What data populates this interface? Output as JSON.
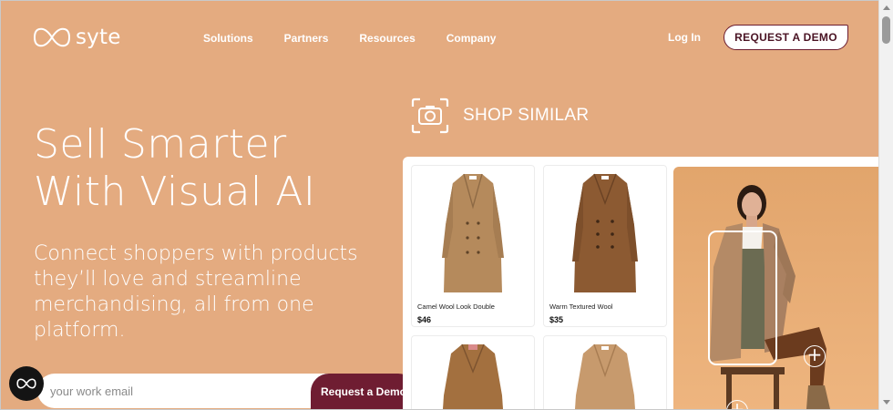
{
  "header": {
    "logo_text": "syte",
    "nav": [
      "Solutions",
      "Partners",
      "Resources",
      "Company"
    ],
    "login_label": "Log In",
    "demo_label": "REQUEST A DEMO"
  },
  "hero": {
    "title_line1": "Sell Smarter",
    "title_line2": "With Visual AI",
    "subtitle": "Connect shoppers with products they’ll love and streamline merchandising, all from one platform.",
    "email_placeholder": "your work email",
    "submit_label": "Request a Demo"
  },
  "shop_similar": {
    "label": "SHOP SIMILAR",
    "products": [
      {
        "name": "Camel Wool Look Double",
        "price": "$46",
        "color": "#b58a5c"
      },
      {
        "name": "Warm Textured Wool",
        "price": "$35",
        "color": "#8c5a32"
      },
      {
        "name": "",
        "price": "",
        "color": "#a3703f"
      },
      {
        "name": "",
        "price": "",
        "color": "#c79a6d"
      }
    ]
  },
  "colors": {
    "background": "#e4ab80",
    "accent": "#6f1d32"
  }
}
